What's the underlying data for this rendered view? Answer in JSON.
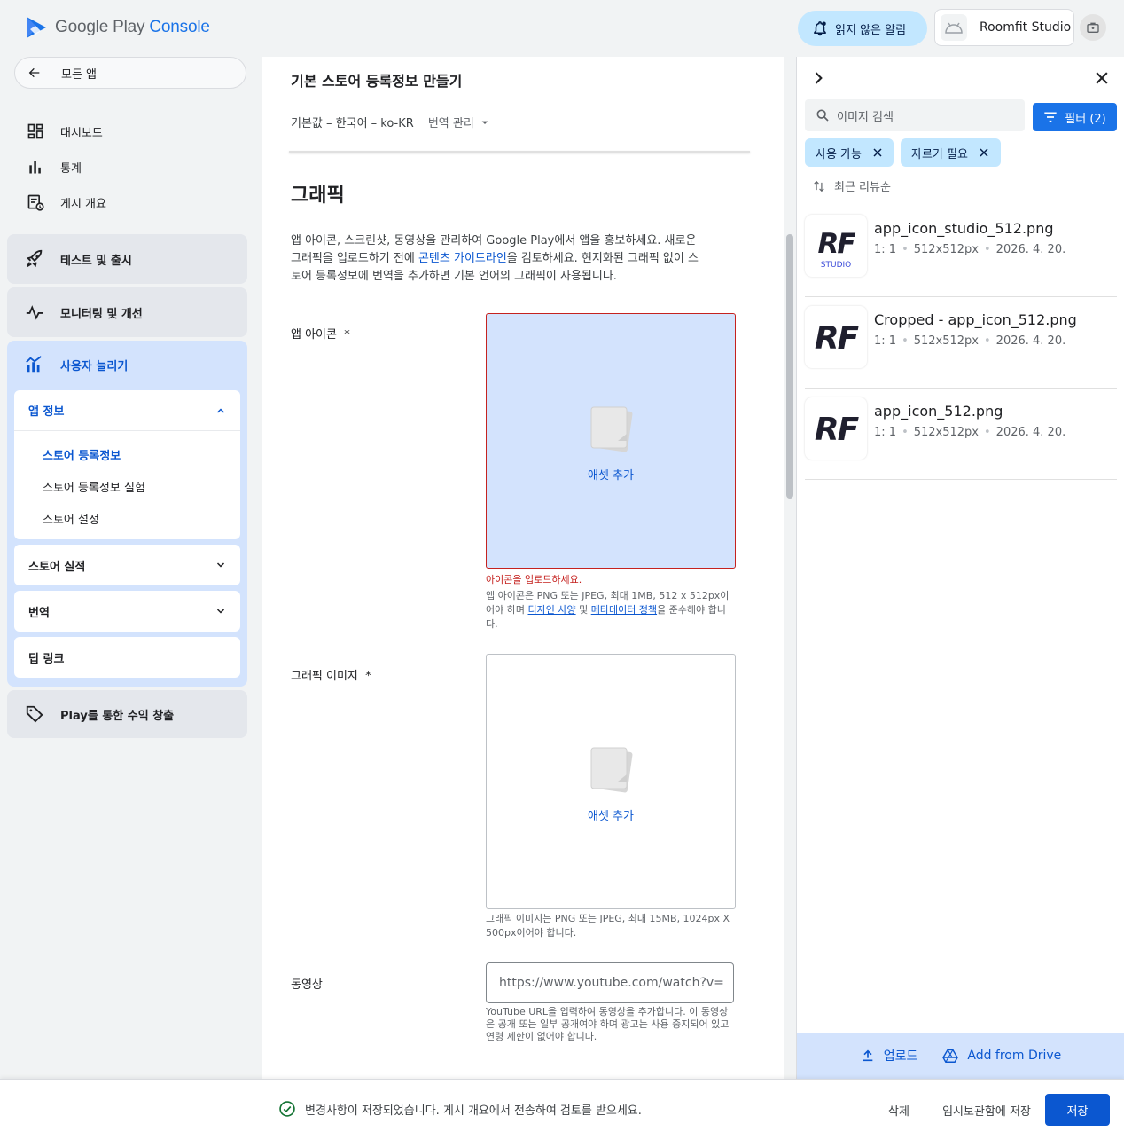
{
  "app": {
    "logo_part1": "Google Play",
    "logo_part2": "Console"
  },
  "topbar": {
    "notifications_label": "읽지 않은 알림",
    "account_name": "Roomfit Studio"
  },
  "sidebar": {
    "all_apps": "모든 앱",
    "items": [
      {
        "label": "대시보드",
        "icon": "dashboard-icon"
      },
      {
        "label": "통계",
        "icon": "bar-chart-icon"
      },
      {
        "label": "게시 개요",
        "icon": "publishing-overview-icon"
      }
    ],
    "cards": [
      {
        "label": "테스트 및 출시",
        "icon": "rocket-icon"
      },
      {
        "label": "모니터링 및 개선",
        "icon": "monitoring-icon"
      }
    ],
    "grow": {
      "label": "사용자 늘리기",
      "app_info": "앱 정보",
      "app_info_items": [
        "스토어 등록정보",
        "스토어 등록정보 실험",
        "스토어 설정"
      ],
      "store_performance": "스토어 실적",
      "translation": "번역",
      "deep_links": "딥 링크"
    },
    "monetize": "Play를 통한 수익 창출"
  },
  "main": {
    "page_title": "기본 스토어 등록정보 만들기",
    "language": "기본값 – 한국어 – ko-KR",
    "manage_translations": "번역 관리",
    "section_title": "그래픽",
    "desc_part1": "앱 아이콘, 스크린샷, 동영상을 관리하여 Google Play에서 앱을 홍보하세요. 새로운 그래픽을 업로드하기 전에 ",
    "desc_link": "콘텐츠 가이드라인",
    "desc_part2": "을 검토하세요. 현지화된 그래픽 없이 스토어 등록정보에 번역을 추가하면 기본 언어의 그래픽이 사용됩니다.",
    "app_icon_label": "앱 아이콘",
    "required_mark": "*",
    "add_asset": "애셋 추가",
    "icon_error": "아이콘을 업로드하세요.",
    "icon_help_part1": "앱 아이콘은 PNG 또는 JPEG, 최대 1MB, 512 x 512px이어야 하며 ",
    "icon_help_link1": "디자인 사양",
    "icon_help_part2": " 및 ",
    "icon_help_link2": "메타데이터 정책",
    "icon_help_part3": "을 준수해야 합니다.",
    "graphic_label": "그래픽 이미지",
    "graphic_help": "그래픽 이미지는 PNG 또는 JPEG, 최대 15MB, 1024px X 500px이어야 합니다.",
    "video_label": "동영상",
    "video_placeholder": "https://www.youtube.com/watch?v=",
    "video_help": "YouTube URL을 입력하여 동영상을 추가합니다. 이 동영상은 공개 또는 일부 공개여야 하며 광고는 사용 중지되어 있고 연령 제한이 없어야 합니다."
  },
  "panel": {
    "search_placeholder": "이미지 검색",
    "filter_label": "필터 (2)",
    "chips": [
      "사용 가능",
      "자르기 필요"
    ],
    "sort_label": "최근 리뷰순",
    "assets": [
      {
        "name": "app_icon_studio_512.png",
        "ratio": "1: 1",
        "size": "512x512px",
        "date": "2026. 4. 20.",
        "thumb_text": "RF",
        "thumb_sub": "STUDIO"
      },
      {
        "name": "Cropped - app_icon_512.png",
        "ratio": "1: 1",
        "size": "512x512px",
        "date": "2026. 4. 20.",
        "thumb_text": "RF",
        "thumb_sub": ""
      },
      {
        "name": "app_icon_512.png",
        "ratio": "1: 1",
        "size": "512x512px",
        "date": "2026. 4. 20.",
        "thumb_text": "RF",
        "thumb_sub": ""
      }
    ],
    "upload_label": "업로드",
    "drive_label": "Add from Drive"
  },
  "footer": {
    "toast": "변경사항이 저장되었습니다. 게시 개요에서 전송하여 검토를 받으세요.",
    "delete": "삭제",
    "save_draft": "임시보관함에 저장",
    "save": "저장"
  },
  "colors": {
    "primary": "#0b57d0",
    "accent_blue": "#1a73e8",
    "error": "#c5221f",
    "selected_bg": "#d3e3fd",
    "chip_bg": "#c2e7ff"
  }
}
